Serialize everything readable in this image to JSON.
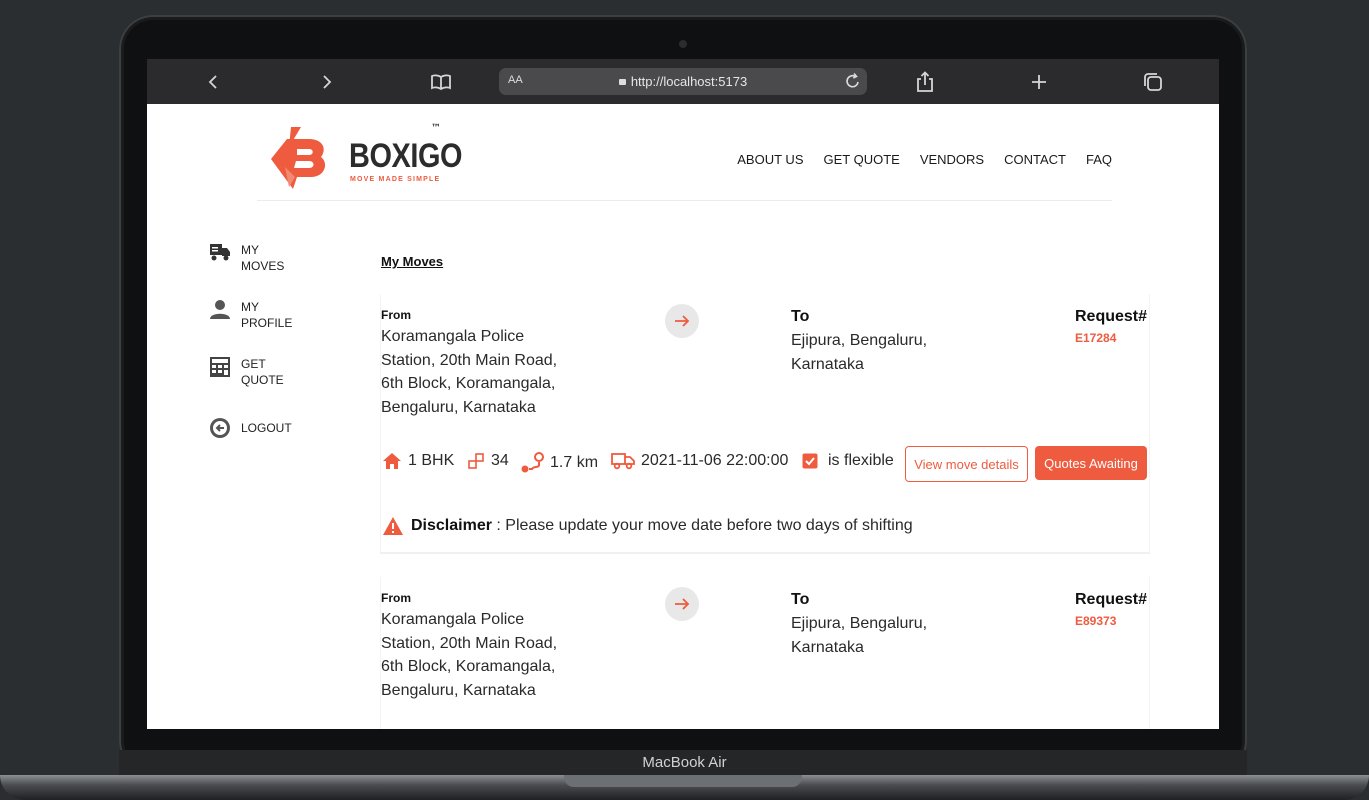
{
  "device": {
    "label": "MacBook Air"
  },
  "browser": {
    "aa": "AA",
    "url": "http://localhost:5173"
  },
  "site": {
    "brand": "BOXIGO",
    "tm": "™",
    "tagline": "MOVE MADE SIMPLE",
    "nav": [
      "ABOUT US",
      "GET QUOTE",
      "VENDORS",
      "CONTACT",
      "FAQ"
    ]
  },
  "sidebar": {
    "items": [
      {
        "line1": "MY",
        "line2": "MOVES",
        "icon": "truck-icon"
      },
      {
        "line1": "MY",
        "line2": "PROFILE",
        "icon": "user-icon"
      },
      {
        "line1": "GET",
        "line2": "QUOTE",
        "icon": "calculator-icon"
      },
      {
        "line1": "LOGOUT",
        "line2": "",
        "icon": "logout-icon"
      }
    ]
  },
  "main": {
    "title": "My Moves",
    "moves": [
      {
        "from_label": "From",
        "from_address_lines": [
          "Koramangala Police",
          "Station, 20th Main Road,",
          "6th Block, Koramangala,",
          "Bengaluru, Karnataka"
        ],
        "to_label": "To",
        "to_address_lines": [
          "Ejipura, Bengaluru,",
          "Karnataka"
        ],
        "request_label": "Request#",
        "request_id": "E17284",
        "property_size": "1 BHK",
        "item_count": "34",
        "distance": "1.7 km",
        "move_date": "2021-11-06 22:00:00",
        "flexible_label": "is flexible",
        "view_button": "View move details",
        "status_button": "Quotes Awaiting",
        "disclaimer_title": "Disclaimer",
        "disclaimer_text": " : Please update your move date before two days of shifting"
      },
      {
        "from_label": "From",
        "from_address_lines": [
          "Koramangala Police",
          "Station, 20th Main Road,",
          "6th Block, Koramangala,",
          "Bengaluru, Karnataka"
        ],
        "to_label": "To",
        "to_address_lines": [
          "Ejipura, Bengaluru,",
          "Karnataka"
        ],
        "request_label": "Request#",
        "request_id": "E89373"
      }
    ]
  },
  "colors": {
    "accent": "#ee5b3f",
    "toolbar": "#2b2b2d",
    "frame": "#0f1011"
  }
}
